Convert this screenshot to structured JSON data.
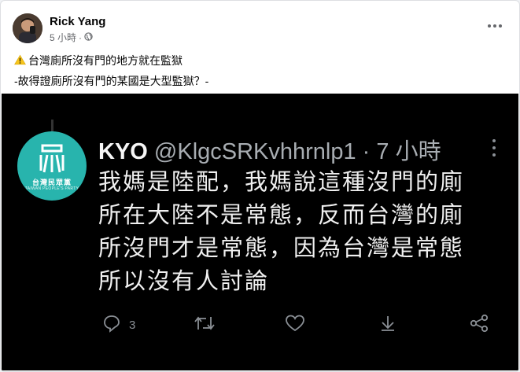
{
  "post": {
    "author": "Rick Yang",
    "time": "5 小時",
    "dot": "·",
    "line1": "台灣廁所沒有門的地方就在監獄",
    "line2": "-故得證廁所沒有門的某國是大型監獄？-"
  },
  "tweet": {
    "avatar_zh": "台灣民眾黨",
    "avatar_en": "TAIWAN PEOPLE'S PARTY",
    "name": "KYO",
    "handle": "@KlgcSRKvhhrnlp1 · 7 小時",
    "lines": [
      "我媽是陸配，我媽說這種沒門的廁",
      "所在大陸不是常態，反而台灣的廁",
      "所沒門才是常態，因為台灣是常態",
      "所以沒有人討論"
    ],
    "reply_count": "3"
  },
  "icons": {
    "warning": "warning-icon",
    "globe": "globe-icon",
    "more": "more-icon",
    "reply": "reply-icon",
    "retweet": "retweet-icon",
    "like": "like-icon",
    "download": "download-icon",
    "share": "share-icon"
  },
  "colors": {
    "tpp_teal": "#28b4ad",
    "warning_yellow": "#f7c51c"
  }
}
